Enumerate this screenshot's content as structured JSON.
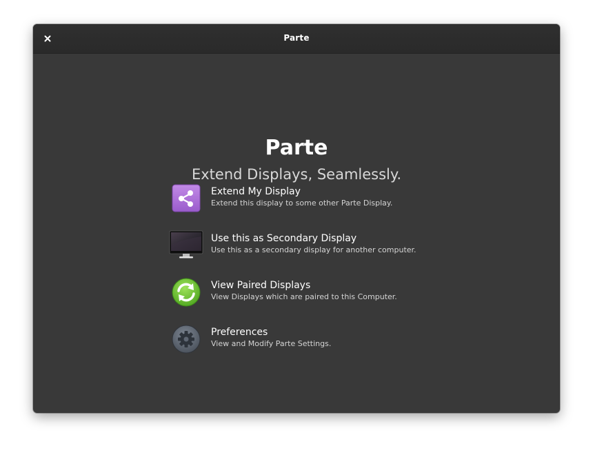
{
  "window": {
    "title": "Parte",
    "close_icon": "close-icon"
  },
  "header": {
    "title": "Parte",
    "subtitle": "Extend Displays, Seamlessly."
  },
  "menu": {
    "items": [
      {
        "label": "Extend My Display",
        "description": "Extend this display to some other Parte Display.",
        "icon": "share-icon",
        "icon_color": "#a86bd6"
      },
      {
        "label": "Use this as Secondary Display",
        "description": "Use this as a secondary display for another computer.",
        "icon": "monitor-icon",
        "icon_color": "#1a1a1a"
      },
      {
        "label": "View Paired Displays",
        "description": "View Displays which are paired to this Computer.",
        "icon": "sync-icon",
        "icon_color": "#6cc330"
      },
      {
        "label": "Preferences",
        "description": "View and Modify Parte Settings.",
        "icon": "gear-icon",
        "icon_color": "#5b6470"
      }
    ]
  },
  "colors": {
    "window_bg": "#393939",
    "titlebar_bg": "#2c2c2c",
    "text_primary": "#ffffff",
    "text_secondary": "#d4d4d4"
  }
}
